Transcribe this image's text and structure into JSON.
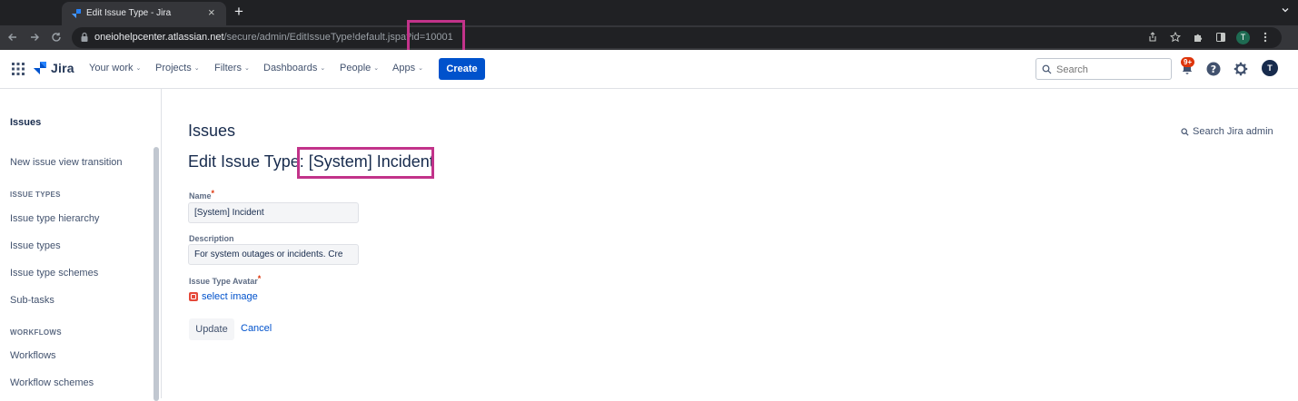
{
  "browser": {
    "tab_title": "Edit Issue Type - Jira",
    "url_host": "oneiohelpcenter.atlassian.net",
    "url_path": "/secure/admin/EditIssueType!default.jspa?id=10001",
    "profile_initial": "T"
  },
  "nav": {
    "logo": "Jira",
    "items": [
      "Your work",
      "Projects",
      "Filters",
      "Dashboards",
      "People",
      "Apps"
    ],
    "create_label": "Create",
    "search_placeholder": "Search",
    "notification_badge": "9+",
    "avatar_initial": "T"
  },
  "sidebar": {
    "title": "Issues",
    "transition_link": "New issue view transition",
    "section_issue_types": "ISSUE TYPES",
    "issue_type_links": [
      "Issue type hierarchy",
      "Issue types",
      "Issue type schemes",
      "Sub-tasks"
    ],
    "section_workflows": "WORKFLOWS",
    "workflow_links": [
      "Workflows",
      "Workflow schemes"
    ]
  },
  "main": {
    "heading": "Issues",
    "admin_search": "Search Jira admin",
    "edit_heading": "Edit Issue Type: [System] Incident",
    "name_label": "Name",
    "name_value": "[System] Incident",
    "description_label": "Description",
    "description_value": "For system outages or incidents. Cre",
    "avatar_label": "Issue Type Avatar",
    "select_image": "select image",
    "update_label": "Update",
    "cancel_label": "Cancel"
  },
  "colors": {
    "accent": "#0052cc",
    "highlight": "#c2338a",
    "required": "#de350b"
  }
}
